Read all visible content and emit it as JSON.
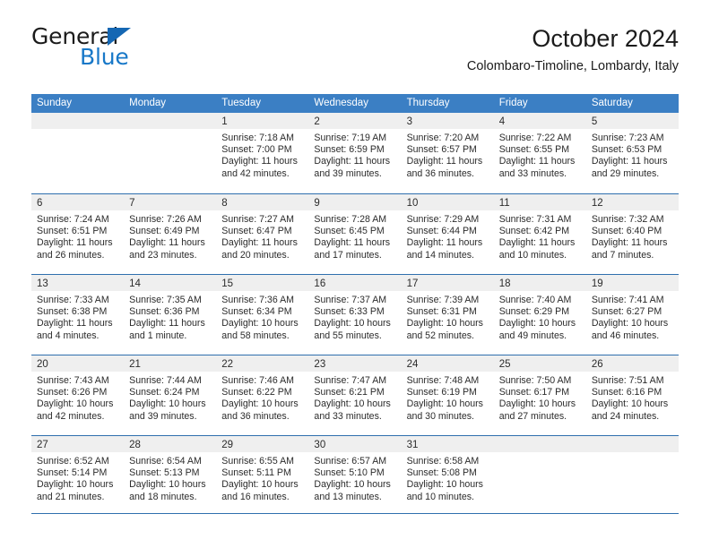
{
  "brand": {
    "name_top": "General",
    "name_bottom": "Blue",
    "accent_color": "#1878c8",
    "triangle_color": "#1567b3"
  },
  "header": {
    "title": "October 2024",
    "subtitle": "Colombaro-Timoline, Lombardy, Italy"
  },
  "theme": {
    "header_row_bg": "#3b7fc4",
    "row_divider": "#2f6fae",
    "day_band_bg": "#efefef",
    "text": "#2b2b2b"
  },
  "weekdays": [
    "Sunday",
    "Monday",
    "Tuesday",
    "Wednesday",
    "Thursday",
    "Friday",
    "Saturday"
  ],
  "weeks": [
    [
      {
        "day": "",
        "sunrise": "",
        "sunset": "",
        "daylight_line1": "",
        "daylight_line2": "",
        "empty": true
      },
      {
        "day": "",
        "sunrise": "",
        "sunset": "",
        "daylight_line1": "",
        "daylight_line2": "",
        "empty": true
      },
      {
        "day": "1",
        "sunrise": "Sunrise: 7:18 AM",
        "sunset": "Sunset: 7:00 PM",
        "daylight_line1": "Daylight: 11 hours",
        "daylight_line2": "and 42 minutes."
      },
      {
        "day": "2",
        "sunrise": "Sunrise: 7:19 AM",
        "sunset": "Sunset: 6:59 PM",
        "daylight_line1": "Daylight: 11 hours",
        "daylight_line2": "and 39 minutes."
      },
      {
        "day": "3",
        "sunrise": "Sunrise: 7:20 AM",
        "sunset": "Sunset: 6:57 PM",
        "daylight_line1": "Daylight: 11 hours",
        "daylight_line2": "and 36 minutes."
      },
      {
        "day": "4",
        "sunrise": "Sunrise: 7:22 AM",
        "sunset": "Sunset: 6:55 PM",
        "daylight_line1": "Daylight: 11 hours",
        "daylight_line2": "and 33 minutes."
      },
      {
        "day": "5",
        "sunrise": "Sunrise: 7:23 AM",
        "sunset": "Sunset: 6:53 PM",
        "daylight_line1": "Daylight: 11 hours",
        "daylight_line2": "and 29 minutes."
      }
    ],
    [
      {
        "day": "6",
        "sunrise": "Sunrise: 7:24 AM",
        "sunset": "Sunset: 6:51 PM",
        "daylight_line1": "Daylight: 11 hours",
        "daylight_line2": "and 26 minutes."
      },
      {
        "day": "7",
        "sunrise": "Sunrise: 7:26 AM",
        "sunset": "Sunset: 6:49 PM",
        "daylight_line1": "Daylight: 11 hours",
        "daylight_line2": "and 23 minutes."
      },
      {
        "day": "8",
        "sunrise": "Sunrise: 7:27 AM",
        "sunset": "Sunset: 6:47 PM",
        "daylight_line1": "Daylight: 11 hours",
        "daylight_line2": "and 20 minutes."
      },
      {
        "day": "9",
        "sunrise": "Sunrise: 7:28 AM",
        "sunset": "Sunset: 6:45 PM",
        "daylight_line1": "Daylight: 11 hours",
        "daylight_line2": "and 17 minutes."
      },
      {
        "day": "10",
        "sunrise": "Sunrise: 7:29 AM",
        "sunset": "Sunset: 6:44 PM",
        "daylight_line1": "Daylight: 11 hours",
        "daylight_line2": "and 14 minutes."
      },
      {
        "day": "11",
        "sunrise": "Sunrise: 7:31 AM",
        "sunset": "Sunset: 6:42 PM",
        "daylight_line1": "Daylight: 11 hours",
        "daylight_line2": "and 10 minutes."
      },
      {
        "day": "12",
        "sunrise": "Sunrise: 7:32 AM",
        "sunset": "Sunset: 6:40 PM",
        "daylight_line1": "Daylight: 11 hours",
        "daylight_line2": "and 7 minutes."
      }
    ],
    [
      {
        "day": "13",
        "sunrise": "Sunrise: 7:33 AM",
        "sunset": "Sunset: 6:38 PM",
        "daylight_line1": "Daylight: 11 hours",
        "daylight_line2": "and 4 minutes."
      },
      {
        "day": "14",
        "sunrise": "Sunrise: 7:35 AM",
        "sunset": "Sunset: 6:36 PM",
        "daylight_line1": "Daylight: 11 hours",
        "daylight_line2": "and 1 minute."
      },
      {
        "day": "15",
        "sunrise": "Sunrise: 7:36 AM",
        "sunset": "Sunset: 6:34 PM",
        "daylight_line1": "Daylight: 10 hours",
        "daylight_line2": "and 58 minutes."
      },
      {
        "day": "16",
        "sunrise": "Sunrise: 7:37 AM",
        "sunset": "Sunset: 6:33 PM",
        "daylight_line1": "Daylight: 10 hours",
        "daylight_line2": "and 55 minutes."
      },
      {
        "day": "17",
        "sunrise": "Sunrise: 7:39 AM",
        "sunset": "Sunset: 6:31 PM",
        "daylight_line1": "Daylight: 10 hours",
        "daylight_line2": "and 52 minutes."
      },
      {
        "day": "18",
        "sunrise": "Sunrise: 7:40 AM",
        "sunset": "Sunset: 6:29 PM",
        "daylight_line1": "Daylight: 10 hours",
        "daylight_line2": "and 49 minutes."
      },
      {
        "day": "19",
        "sunrise": "Sunrise: 7:41 AM",
        "sunset": "Sunset: 6:27 PM",
        "daylight_line1": "Daylight: 10 hours",
        "daylight_line2": "and 46 minutes."
      }
    ],
    [
      {
        "day": "20",
        "sunrise": "Sunrise: 7:43 AM",
        "sunset": "Sunset: 6:26 PM",
        "daylight_line1": "Daylight: 10 hours",
        "daylight_line2": "and 42 minutes."
      },
      {
        "day": "21",
        "sunrise": "Sunrise: 7:44 AM",
        "sunset": "Sunset: 6:24 PM",
        "daylight_line1": "Daylight: 10 hours",
        "daylight_line2": "and 39 minutes."
      },
      {
        "day": "22",
        "sunrise": "Sunrise: 7:46 AM",
        "sunset": "Sunset: 6:22 PM",
        "daylight_line1": "Daylight: 10 hours",
        "daylight_line2": "and 36 minutes."
      },
      {
        "day": "23",
        "sunrise": "Sunrise: 7:47 AM",
        "sunset": "Sunset: 6:21 PM",
        "daylight_line1": "Daylight: 10 hours",
        "daylight_line2": "and 33 minutes."
      },
      {
        "day": "24",
        "sunrise": "Sunrise: 7:48 AM",
        "sunset": "Sunset: 6:19 PM",
        "daylight_line1": "Daylight: 10 hours",
        "daylight_line2": "and 30 minutes."
      },
      {
        "day": "25",
        "sunrise": "Sunrise: 7:50 AM",
        "sunset": "Sunset: 6:17 PM",
        "daylight_line1": "Daylight: 10 hours",
        "daylight_line2": "and 27 minutes."
      },
      {
        "day": "26",
        "sunrise": "Sunrise: 7:51 AM",
        "sunset": "Sunset: 6:16 PM",
        "daylight_line1": "Daylight: 10 hours",
        "daylight_line2": "and 24 minutes."
      }
    ],
    [
      {
        "day": "27",
        "sunrise": "Sunrise: 6:52 AM",
        "sunset": "Sunset: 5:14 PM",
        "daylight_line1": "Daylight: 10 hours",
        "daylight_line2": "and 21 minutes."
      },
      {
        "day": "28",
        "sunrise": "Sunrise: 6:54 AM",
        "sunset": "Sunset: 5:13 PM",
        "daylight_line1": "Daylight: 10 hours",
        "daylight_line2": "and 18 minutes."
      },
      {
        "day": "29",
        "sunrise": "Sunrise: 6:55 AM",
        "sunset": "Sunset: 5:11 PM",
        "daylight_line1": "Daylight: 10 hours",
        "daylight_line2": "and 16 minutes."
      },
      {
        "day": "30",
        "sunrise": "Sunrise: 6:57 AM",
        "sunset": "Sunset: 5:10 PM",
        "daylight_line1": "Daylight: 10 hours",
        "daylight_line2": "and 13 minutes."
      },
      {
        "day": "31",
        "sunrise": "Sunrise: 6:58 AM",
        "sunset": "Sunset: 5:08 PM",
        "daylight_line1": "Daylight: 10 hours",
        "daylight_line2": "and 10 minutes."
      },
      {
        "day": "",
        "sunrise": "",
        "sunset": "",
        "daylight_line1": "",
        "daylight_line2": "",
        "empty": true
      },
      {
        "day": "",
        "sunrise": "",
        "sunset": "",
        "daylight_line1": "",
        "daylight_line2": "",
        "empty": true
      }
    ]
  ]
}
